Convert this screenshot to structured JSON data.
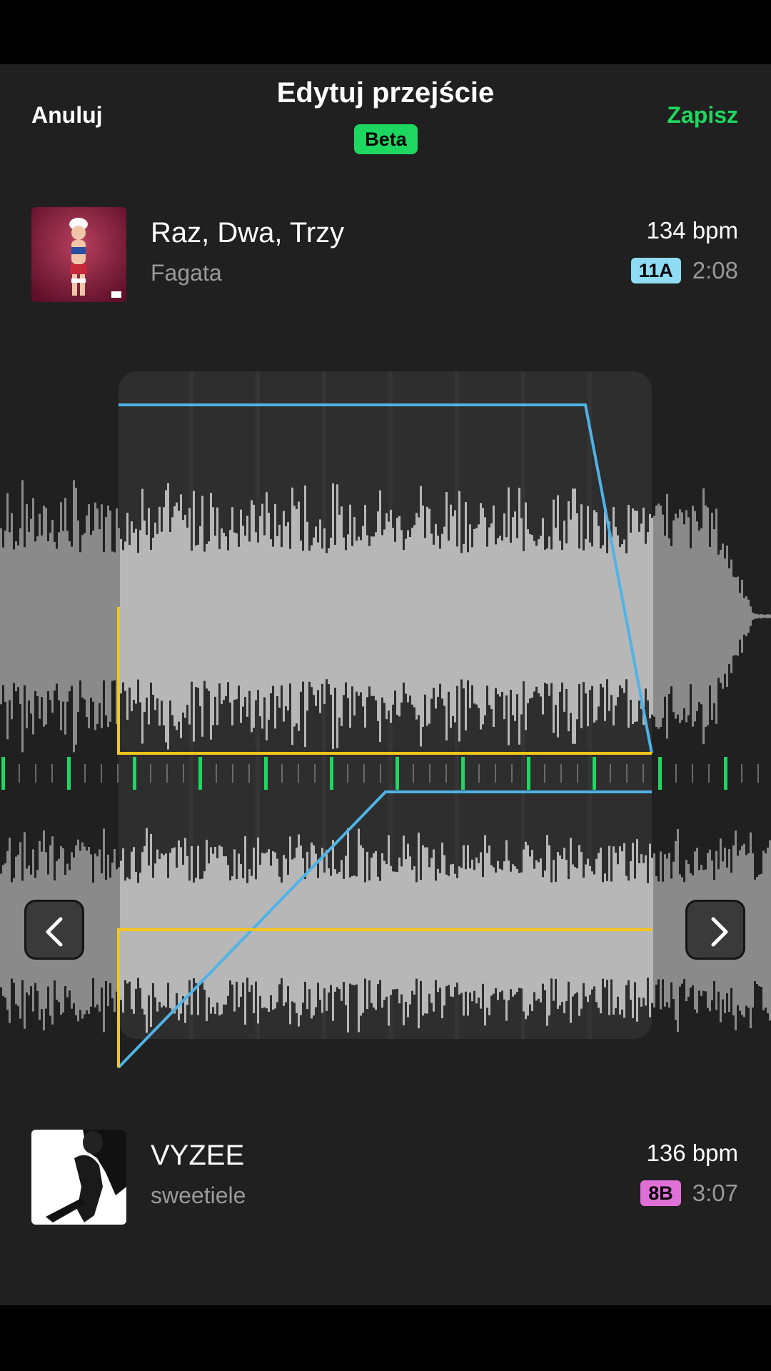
{
  "header": {
    "cancel_label": "Anuluj",
    "title": "Edytuj przejście",
    "beta_label": "Beta",
    "save_label": "Zapisz"
  },
  "track_a": {
    "title": "Raz, Dwa, Trzy",
    "artist": "Fagata",
    "bpm": "134 bpm",
    "key": "11A",
    "key_color": "#8fdcf5",
    "duration": "2:08"
  },
  "track_b": {
    "title": "VYZEE",
    "artist": "sweetiele",
    "bpm": "136 bpm",
    "key": "8B",
    "key_color": "#e070d8",
    "duration": "3:07"
  },
  "editor": {
    "accent_colors": {
      "volume_curve": "#4fb3e6",
      "eq_curve": "#f5c518",
      "beat_marker": "#1ed760"
    },
    "icons": [
      "chevron-left-icon",
      "chevron-right-icon"
    ]
  }
}
